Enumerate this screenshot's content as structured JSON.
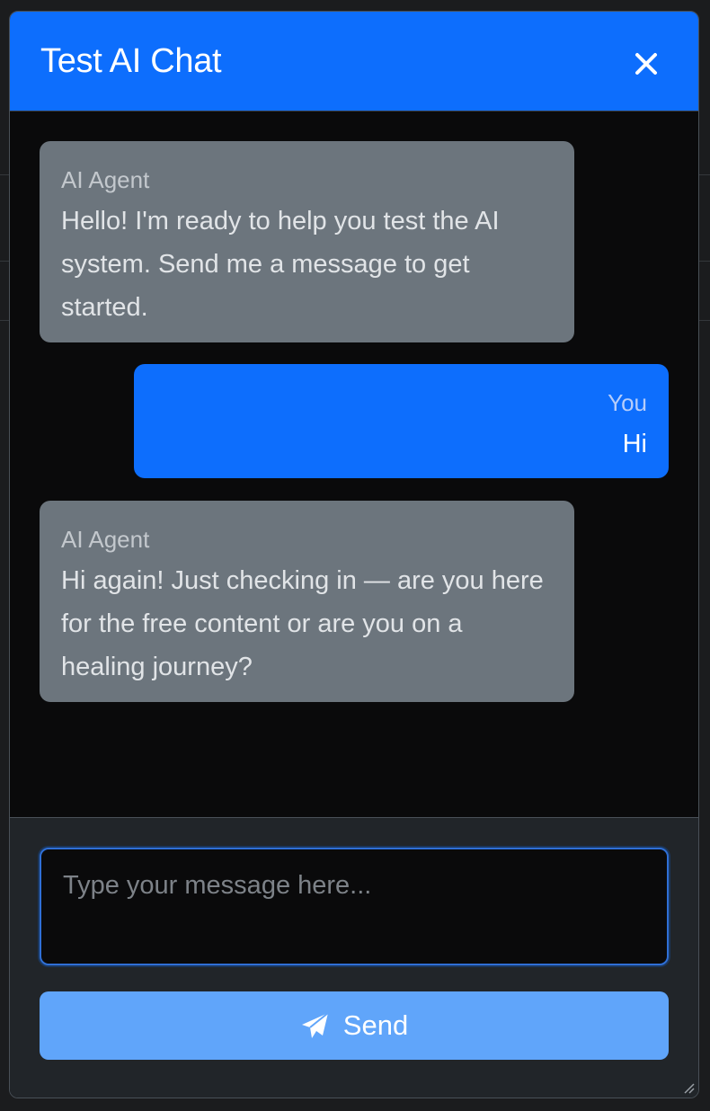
{
  "modal": {
    "title": "Test AI Chat",
    "close_icon": "close-icon"
  },
  "messages": [
    {
      "sender": "AI Agent",
      "text": "Hello! I'm ready to help you test the AI system. Send me a message to get started.",
      "role": "ai"
    },
    {
      "sender": "You",
      "text": "Hi",
      "role": "user"
    },
    {
      "sender": "AI Agent",
      "text": "Hi again! Just checking in — are you here for the free content or are you on a healing journey?",
      "role": "ai"
    }
  ],
  "composer": {
    "placeholder": "Type your message here...",
    "value": "",
    "send_label": "Send",
    "send_icon": "paper-plane-icon"
  },
  "colors": {
    "accent": "#0d6efd",
    "ai_bubble": "#6c757d",
    "send_button": "#60a5fa"
  }
}
